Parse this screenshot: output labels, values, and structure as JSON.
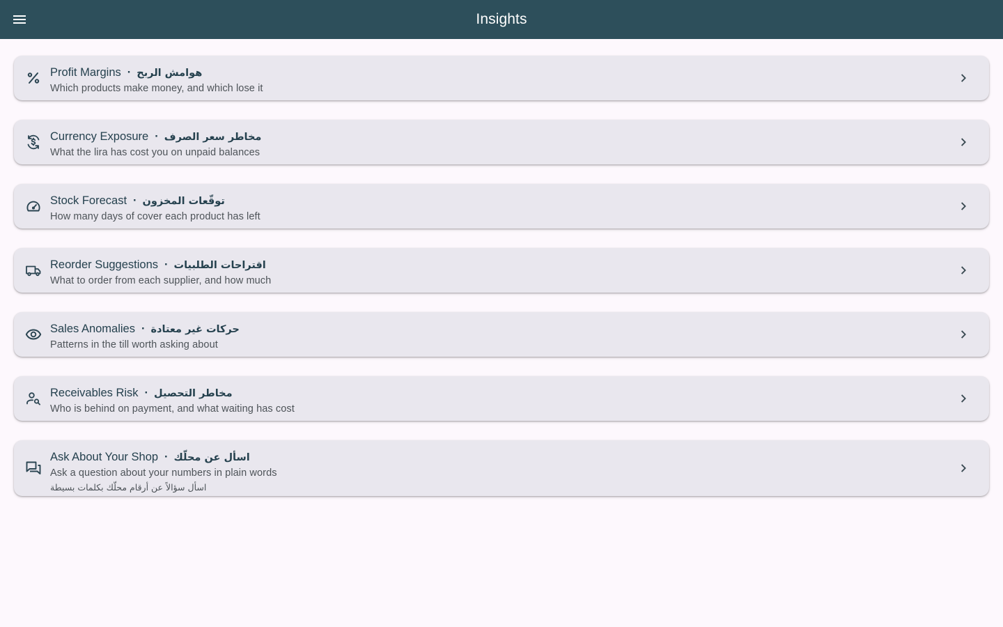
{
  "appbar": {
    "title": "Insights",
    "menu_icon": "menu-icon"
  },
  "colors": {
    "appbar": "#2d4f5b",
    "background": "#fdf8fd",
    "card": "#e9e7ee",
    "title_text": "#25414e",
    "subtitle_text": "#4d5358"
  },
  "insights": [
    {
      "icon": "percent-icon",
      "title_en": "Profit Margins",
      "separator": "·",
      "title_ar": "هوامش الربح",
      "subtitle": "Which products make money, and which lose it"
    },
    {
      "icon": "currency-exchange-icon",
      "title_en": "Currency Exposure",
      "separator": "·",
      "title_ar": "مخاطر سعر الصرف",
      "subtitle": "What the lira has cost you on unpaid balances"
    },
    {
      "icon": "speedometer-icon",
      "title_en": "Stock Forecast",
      "separator": "·",
      "title_ar": "توقّعات المخزون",
      "subtitle": "How many days of cover each product has left"
    },
    {
      "icon": "truck-icon",
      "title_en": "Reorder Suggestions",
      "separator": "·",
      "title_ar": "اقتراحات الطلبيات",
      "subtitle": "What to order from each supplier, and how much"
    },
    {
      "icon": "eye-icon",
      "title_en": "Sales Anomalies",
      "separator": "·",
      "title_ar": "حركات غير معتادة",
      "subtitle": "Patterns in the till worth asking about"
    },
    {
      "icon": "person-search-icon",
      "title_en": "Receivables Risk",
      "separator": "·",
      "title_ar": "مخاطر التحصيل",
      "subtitle": "Who is behind on payment, and what waiting has cost"
    },
    {
      "icon": "chat-bubbles-icon",
      "title_en": "Ask About Your Shop",
      "separator": "·",
      "title_ar": "اسأل عن محلّك",
      "subtitle": "Ask a question about your numbers in plain words",
      "subtitle_ar": "اسأل سؤالاً عن أرقام محلّك بكلمات بسيطة"
    }
  ]
}
